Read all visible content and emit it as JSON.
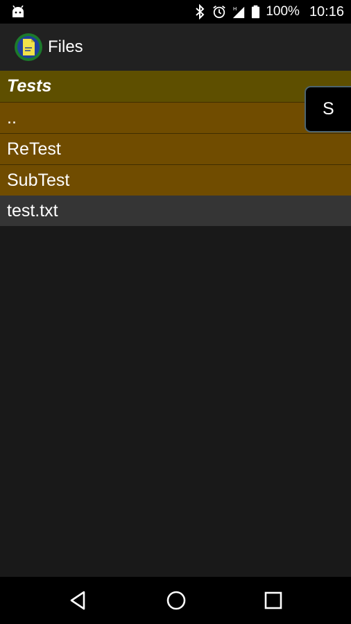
{
  "status_bar": {
    "icons": [
      "android-icon",
      "bluetooth-icon",
      "alarm-icon",
      "signal-icon",
      "battery-icon"
    ],
    "battery": "100%",
    "time": "10:16"
  },
  "app_bar": {
    "title": "Files",
    "logo": "files-app-logo"
  },
  "file_list": {
    "header": "Tests",
    "items": [
      {
        "label": "..",
        "type": "directory"
      },
      {
        "label": "ReTest",
        "type": "directory"
      },
      {
        "label": "SubTest",
        "type": "directory"
      },
      {
        "label": "test.txt",
        "type": "file"
      }
    ]
  },
  "side_button": {
    "label": "S"
  },
  "nav_bar": {
    "buttons": [
      "back-icon",
      "home-icon",
      "recents-icon"
    ]
  },
  "colors": {
    "header_row": "#5e4f00",
    "directory_row": "#704c00",
    "file_row": "#353535",
    "background": "#191919",
    "app_bar": "#212121"
  }
}
